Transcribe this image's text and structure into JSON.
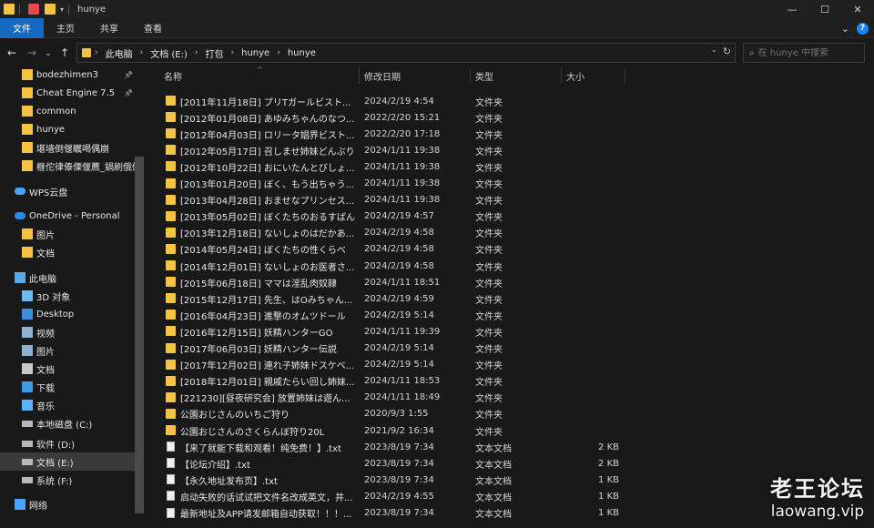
{
  "titlebar": {
    "title": "hunye",
    "minimize": "—",
    "maximize": "☐",
    "close": "✕"
  },
  "ribbon": {
    "tabs": [
      "文件",
      "主页",
      "共享",
      "查看"
    ],
    "active": 0,
    "expand": "⌄",
    "help": "?"
  },
  "nav": {
    "crumbs": [
      "此电脑",
      "文档 (E:)",
      "打包",
      "hunye",
      "hunye"
    ],
    "search_placeholder": "在 hunye 中搜索"
  },
  "sidebar": {
    "items": [
      {
        "label": "bodezhimen3",
        "icon": "folder-icon",
        "pinned": true,
        "indent": 1
      },
      {
        "label": "Cheat Engine 7.5",
        "icon": "folder-icon",
        "pinned": true,
        "indent": 1
      },
      {
        "label": "common",
        "icon": "folder-icon",
        "pinned": false,
        "indent": 1
      },
      {
        "label": "hunye",
        "icon": "folder-icon",
        "pinned": false,
        "indent": 1
      },
      {
        "label": "堪墙倒偃瞩喝偶崩",
        "icon": "folder-icon",
        "pinned": false,
        "indent": 1
      },
      {
        "label": "榧佗律傣傈偃藨_鍋刷俄倒",
        "icon": "folder-icon",
        "pinned": false,
        "indent": 1
      },
      {
        "label": "WPS云盘",
        "icon": "cloud-icon",
        "pinned": false,
        "indent": 0
      },
      {
        "label": "OneDrive - Personal",
        "icon": "onedrive-icon",
        "pinned": false,
        "indent": 0
      },
      {
        "label": "图片",
        "icon": "folder-icon",
        "pinned": false,
        "indent": 1
      },
      {
        "label": "文档",
        "icon": "folder-icon",
        "pinned": false,
        "indent": 1
      },
      {
        "label": "此电脑",
        "icon": "computer-icon",
        "pinned": false,
        "indent": 0
      },
      {
        "label": "3D 对象",
        "icon": "3d-objects-icon",
        "pinned": false,
        "indent": 1
      },
      {
        "label": "Desktop",
        "icon": "desktop-icon",
        "pinned": false,
        "indent": 1
      },
      {
        "label": "视频",
        "icon": "video-icon",
        "pinned": false,
        "indent": 1
      },
      {
        "label": "图片",
        "icon": "pictures-icon",
        "pinned": false,
        "indent": 1
      },
      {
        "label": "文档",
        "icon": "documents-icon",
        "pinned": false,
        "indent": 1
      },
      {
        "label": "下载",
        "icon": "download-icon",
        "pinned": false,
        "indent": 1
      },
      {
        "label": "音乐",
        "icon": "music-icon",
        "pinned": false,
        "indent": 1
      },
      {
        "label": "本地磁盘 (C:)",
        "icon": "drive-icon",
        "pinned": false,
        "indent": 1
      },
      {
        "label": "软件 (D:)",
        "icon": "drive-icon",
        "pinned": false,
        "indent": 1
      },
      {
        "label": "文档 (E:)",
        "icon": "drive-icon",
        "pinned": false,
        "indent": 1,
        "selected": true
      },
      {
        "label": "系统 (F:)",
        "icon": "drive-icon",
        "pinned": false,
        "indent": 1
      },
      {
        "label": "网络",
        "icon": "network-icon",
        "pinned": false,
        "indent": 0
      }
    ]
  },
  "columns": {
    "name": "名称",
    "date": "修改日期",
    "type": "类型",
    "size": "大小"
  },
  "files": [
    {
      "name": "[2011年11月18日] プリTガールビスト...",
      "date": "2024/2/19 4:54",
      "type": "文件夹",
      "size": "",
      "kind": "folder"
    },
    {
      "name": "[2012年01月08日] あゆみちゃんのなつ...",
      "date": "2022/2/20 15:21",
      "type": "文件夹",
      "size": "",
      "kind": "folder"
    },
    {
      "name": "[2012年04月03日] ロリータ娼界ビスト...",
      "date": "2022/2/20 17:18",
      "type": "文件夹",
      "size": "",
      "kind": "folder"
    },
    {
      "name": "[2012年05月17日] 召しませ姉妹どんぶり",
      "date": "2024/1/11 19:38",
      "type": "文件夹",
      "size": "",
      "kind": "folder"
    },
    {
      "name": "[2012年10月22日] おにいたんとびしょ...",
      "date": "2024/1/11 19:38",
      "type": "文件夹",
      "size": "",
      "kind": "folder"
    },
    {
      "name": "[2013年01月20日] ぼく、もう出ちゃう...",
      "date": "2024/1/11 19:38",
      "type": "文件夹",
      "size": "",
      "kind": "folder"
    },
    {
      "name": "[2013年04月28日] おませなプリンセス...",
      "date": "2024/1/11 19:38",
      "type": "文件夹",
      "size": "",
      "kind": "folder"
    },
    {
      "name": "[2013年05月02日] ぼくたちのおるすばん",
      "date": "2024/2/19 4:57",
      "type": "文件夹",
      "size": "",
      "kind": "folder"
    },
    {
      "name": "[2013年12月18日] ないしょのはだかあ...",
      "date": "2024/2/19 4:58",
      "type": "文件夹",
      "size": "",
      "kind": "folder"
    },
    {
      "name": "[2014年05月24日] ぼくたちの性くらべ",
      "date": "2024/2/19 4:58",
      "type": "文件夹",
      "size": "",
      "kind": "folder"
    },
    {
      "name": "[2014年12月01日] ないしょのお医者さ...",
      "date": "2024/2/19 4:58",
      "type": "文件夹",
      "size": "",
      "kind": "folder"
    },
    {
      "name": "[2015年06月18日] ママは淫乱肉奴隷",
      "date": "2024/1/11 18:51",
      "type": "文件夹",
      "size": "",
      "kind": "folder"
    },
    {
      "name": "[2015年12月17日] 先生、はOみちゃん...",
      "date": "2024/2/19 4:59",
      "type": "文件夹",
      "size": "",
      "kind": "folder"
    },
    {
      "name": "[2016年04月23日] 進撃のオムツドール",
      "date": "2024/2/19 5:14",
      "type": "文件夹",
      "size": "",
      "kind": "folder"
    },
    {
      "name": "[2016年12月15日] 妖精ハンターGO",
      "date": "2024/1/11 19:39",
      "type": "文件夹",
      "size": "",
      "kind": "folder"
    },
    {
      "name": "[2017年06月03日] 妖精ハンター伝説",
      "date": "2024/2/19 5:14",
      "type": "文件夹",
      "size": "",
      "kind": "folder"
    },
    {
      "name": "[2017年12月02日] 連れ子姉妹ドスケベ...",
      "date": "2024/2/19 5:14",
      "type": "文件夹",
      "size": "",
      "kind": "folder"
    },
    {
      "name": "[2018年12月01日] 親戚たらい回し姉妹...",
      "date": "2024/1/11 18:53",
      "type": "文件夹",
      "size": "",
      "kind": "folder"
    },
    {
      "name": "[221230][昼夜研究会] 放置姉妹は遊ん...",
      "date": "2024/1/11 18:49",
      "type": "文件夹",
      "size": "",
      "kind": "folder"
    },
    {
      "name": "公園おじさんのいちご狩り",
      "date": "2020/9/3 1:55",
      "type": "文件夹",
      "size": "",
      "kind": "folder"
    },
    {
      "name": "公園おじさんのさくらんぼ狩り20L",
      "date": "2021/9/2 16:34",
      "type": "文件夹",
      "size": "",
      "kind": "folder"
    },
    {
      "name": "【来了就能下载和观看！纯免费！】.txt",
      "date": "2023/8/19 7:34",
      "type": "文本文档",
      "size": "2 KB",
      "kind": "file"
    },
    {
      "name": "【论坛介绍】.txt",
      "date": "2023/8/19 7:34",
      "type": "文本文档",
      "size": "2 KB",
      "kind": "file"
    },
    {
      "name": "【永久地址发布页】.txt",
      "date": "2023/8/19 7:34",
      "type": "文本文档",
      "size": "1 KB",
      "kind": "file"
    },
    {
      "name": "启动失败的话试试把文件名改成英文，并...",
      "date": "2024/2/19 4:55",
      "type": "文本文档",
      "size": "1 KB",
      "kind": "file"
    },
    {
      "name": "最新地址及APP请发邮箱自动获取！！！...",
      "date": "2023/8/19 7:34",
      "type": "文本文档",
      "size": "1 KB",
      "kind": "file"
    }
  ],
  "watermark": {
    "line1": "老王论坛",
    "line2": "laowang.vip"
  }
}
